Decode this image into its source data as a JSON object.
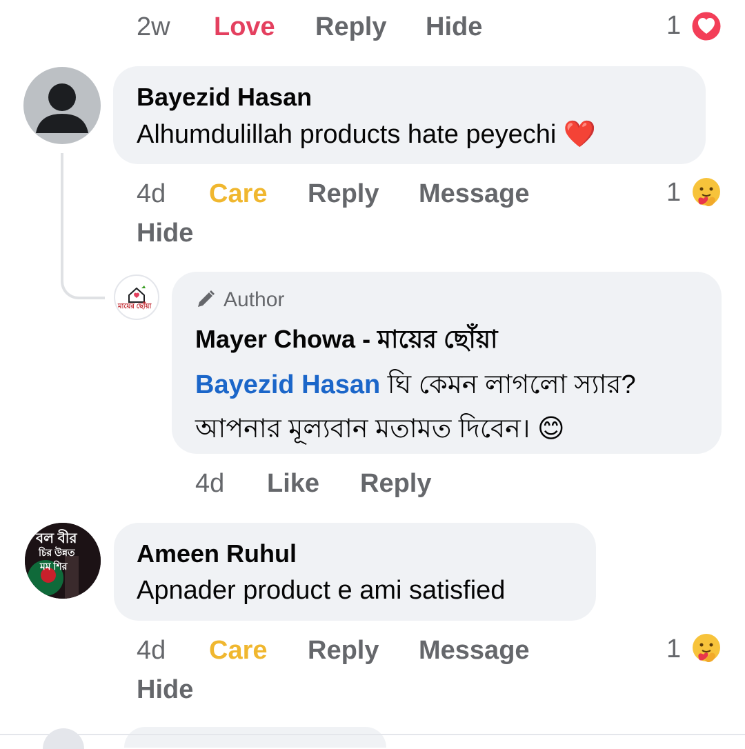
{
  "top_actions": {
    "time": "2w",
    "reaction_label": "Love",
    "reply_label": "Reply",
    "hide_label": "Hide",
    "reaction_count": "1"
  },
  "comments": [
    {
      "author": "Bayezid Hasan",
      "text": "Alhumdulillah products hate peyechi ❤️",
      "time": "4d",
      "reaction_label": "Care",
      "reply_label": "Reply",
      "message_label": "Message",
      "hide_label": "Hide",
      "reaction_count": "1"
    },
    {
      "badge": "Author",
      "author": "Mayer Chowa - মায়ের ছোঁয়া",
      "mention": "Bayezid Hasan",
      "text_line1": " ঘি কেমন লাগলো স্যার?",
      "text_line2": "আপনার মূল্যবান মতামত দিবেন। 😊",
      "avatar_text": "মায়ের ছোঁয়া",
      "time": "4d",
      "like_label": "Like",
      "reply_label": "Reply"
    },
    {
      "author": "Ameen Ruhul",
      "text": "Apnader product e ami satisfied",
      "avatar_text": [
        "বল বীর",
        "চির উন্নত",
        "মম শির"
      ],
      "time": "4d",
      "reaction_label": "Care",
      "reply_label": "Reply",
      "message_label": "Message",
      "hide_label": "Hide",
      "reaction_count": "1"
    }
  ],
  "colors": {
    "love": "#e4405f",
    "care": "#f0b72f",
    "mention": "#1b66c9",
    "bubble": "#f0f2f5",
    "meta": "#65676b"
  }
}
